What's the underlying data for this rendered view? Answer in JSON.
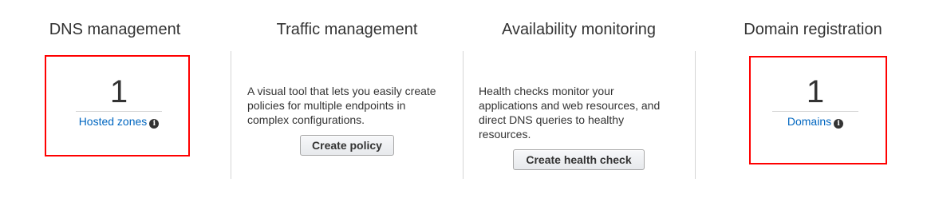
{
  "sections": {
    "dns": {
      "title": "DNS management",
      "count": "1",
      "link_label": "Hosted zones",
      "info_glyph": "i"
    },
    "traffic": {
      "title": "Traffic management",
      "description": "A visual tool that lets you easily create policies for multiple endpoints in complex configurations.",
      "button_label": "Create policy"
    },
    "availability": {
      "title": "Availability monitoring",
      "description": "Health checks monitor your applications and web resources, and direct DNS queries to healthy resources.",
      "button_label": "Create health check"
    },
    "domain": {
      "title": "Domain registration",
      "count": "1",
      "link_label": "Domains",
      "info_glyph": "i"
    }
  },
  "icons": {
    "info": "info-icon"
  },
  "colors": {
    "link": "#0066c0",
    "text": "#333333",
    "divider": "#d5d5d5",
    "highlight": "#ff0000",
    "button_border": "#a8a8a8"
  }
}
